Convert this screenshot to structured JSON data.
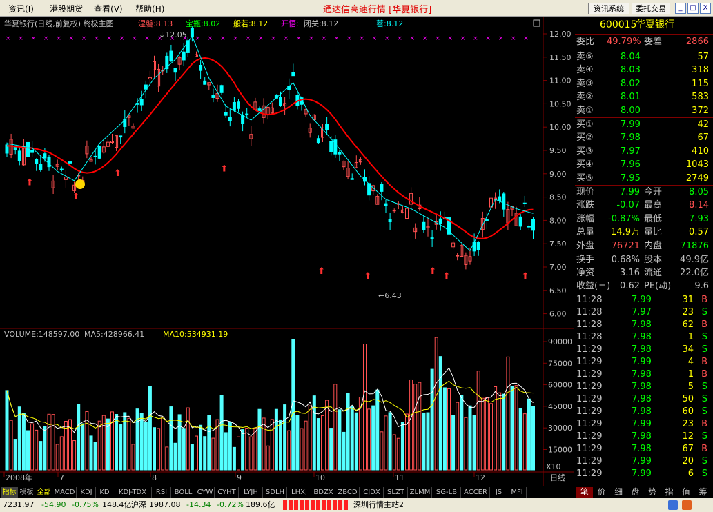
{
  "menu": {
    "items": [
      "资讯",
      "港股期货",
      "查看",
      "帮助"
    ],
    "shortcuts": [
      "(I)",
      "(Y)",
      "(V)",
      "(H)"
    ]
  },
  "app_title": "通达信高速行情 [华夏银行]",
  "top_buttons": {
    "news": "资讯系统",
    "trade": "委托交易"
  },
  "window_buttons": [
    "_",
    "□",
    "X"
  ],
  "chart_header": {
    "name": "华夏银行(日线,前复权) 終极主图",
    "items": [
      {
        "label": "涅磐:8.13",
        "color": "#ff5050"
      },
      {
        "label": "宝瓶:8.02",
        "color": "#00ff00"
      },
      {
        "label": "般若:8.12",
        "color": "#ffff00"
      },
      {
        "label": "开悟:",
        "color": "#ff00ff"
      },
      {
        "label": "闭关:8.12",
        "color": "#c0c0c0"
      },
      {
        "label": "苕:8.12",
        "color": "#00ffff"
      }
    ]
  },
  "price_axis": [
    "12.00",
    "11.50",
    "11.00",
    "10.50",
    "10.00",
    "9.50",
    "9.00",
    "8.50",
    "8.00",
    "7.50",
    "7.00",
    "6.50",
    "6.00"
  ],
  "annotations": {
    "high": "12.05",
    "low": "6.43",
    "high_arrow": "↓",
    "low_arrow": "←"
  },
  "volume_header": {
    "volume": "VOLUME:148597.00",
    "ma5": "MA5:428966.41",
    "ma10": "MA10:534931.19"
  },
  "volume_axis": [
    "90000",
    "75000",
    "60000",
    "45000",
    "30000",
    "15000"
  ],
  "volume_unit": "X10",
  "date_axis": {
    "year": "2008年",
    "months": [
      "7",
      "8",
      "9",
      "10",
      "11",
      "12"
    ]
  },
  "period_label": "日线",
  "indicator_tabs": [
    "指标",
    "模板",
    "全部",
    "MACD",
    "KDJ",
    "KD",
    "KDJ-TDX",
    "RSI",
    "BOLL",
    "CYW",
    "CYHT",
    "LYJH",
    "SDLH",
    "LHXJ",
    "BDZX",
    "ZBCD",
    "CJDX",
    "SLZT",
    "ZLMM",
    "SG-LB",
    "ACCER",
    "JS",
    "MFI"
  ],
  "quote": {
    "code": "600015",
    "name": "华夏银行",
    "weibi_label": "委比",
    "weibi": "49.79%",
    "weicha_label": "委差",
    "weicha": "2866",
    "sells": [
      {
        "label": "卖⑤",
        "price": "8.04",
        "vol": "57"
      },
      {
        "label": "卖④",
        "price": "8.03",
        "vol": "318"
      },
      {
        "label": "卖③",
        "price": "8.02",
        "vol": "115"
      },
      {
        "label": "卖②",
        "price": "8.01",
        "vol": "583"
      },
      {
        "label": "卖①",
        "price": "8.00",
        "vol": "372"
      }
    ],
    "buys": [
      {
        "label": "买①",
        "price": "7.99",
        "vol": "42"
      },
      {
        "label": "买②",
        "price": "7.98",
        "vol": "67"
      },
      {
        "label": "买③",
        "price": "7.97",
        "vol": "410"
      },
      {
        "label": "买④",
        "price": "7.96",
        "vol": "1043"
      },
      {
        "label": "买⑤",
        "price": "7.95",
        "vol": "2749"
      }
    ],
    "stats": [
      {
        "l1": "现价",
        "v1": "7.99",
        "c1": "#00ff00",
        "l2": "今开",
        "v2": "8.05",
        "c2": "#00ff00"
      },
      {
        "l1": "涨跌",
        "v1": "-0.07",
        "c1": "#00ff00",
        "l2": "最高",
        "v2": "8.14",
        "c2": "#ff5050"
      },
      {
        "l1": "涨幅",
        "v1": "-0.87%",
        "c1": "#00ff00",
        "l2": "最低",
        "v2": "7.93",
        "c2": "#00ff00"
      },
      {
        "l1": "总量",
        "v1": "14.9万",
        "c1": "#ffff00",
        "l2": "量比",
        "v2": "0.57",
        "c2": "#ffff00"
      },
      {
        "l1": "外盘",
        "v1": "76721",
        "c1": "#ff5050",
        "l2": "内盘",
        "v2": "71876",
        "c2": "#00ff00"
      }
    ],
    "stats2": [
      {
        "l1": "换手",
        "v1": "0.68%",
        "l2": "股本",
        "v2": "49.9亿"
      },
      {
        "l1": "净资",
        "v1": "3.16",
        "l2": "流通",
        "v2": "22.0亿"
      },
      {
        "l1": "收益(三)",
        "v1": "0.62",
        "l2": "PE(动)",
        "v2": "9.6"
      }
    ],
    "ticks": [
      {
        "time": "11:28",
        "price": "7.99",
        "vol": "31",
        "side": "B"
      },
      {
        "time": "11:28",
        "price": "7.97",
        "vol": "23",
        "side": "S"
      },
      {
        "time": "11:28",
        "price": "7.98",
        "vol": "62",
        "side": "B"
      },
      {
        "time": "11:28",
        "price": "7.98",
        "vol": "1",
        "side": "S"
      },
      {
        "time": "11:29",
        "price": "7.98",
        "vol": "34",
        "side": "S"
      },
      {
        "time": "11:29",
        "price": "7.99",
        "vol": "4",
        "side": "B"
      },
      {
        "time": "11:29",
        "price": "7.98",
        "vol": "1",
        "side": "B"
      },
      {
        "time": "11:29",
        "price": "7.98",
        "vol": "5",
        "side": "S"
      },
      {
        "time": "11:29",
        "price": "7.98",
        "vol": "50",
        "side": "S"
      },
      {
        "time": "11:29",
        "price": "7.98",
        "vol": "60",
        "side": "S"
      },
      {
        "time": "11:29",
        "price": "7.99",
        "vol": "23",
        "side": "B"
      },
      {
        "time": "11:29",
        "price": "7.98",
        "vol": "12",
        "side": "S"
      },
      {
        "time": "11:29",
        "price": "7.98",
        "vol": "67",
        "side": "B"
      },
      {
        "time": "11:29",
        "price": "7.99",
        "vol": "20",
        "side": "S"
      },
      {
        "time": "11:29",
        "price": "7.99",
        "vol": "6",
        "side": "S"
      }
    ],
    "side_tabs": [
      "笔",
      "价",
      "细",
      "盘",
      "势",
      "指",
      "值",
      "筹"
    ]
  },
  "status": {
    "sh_index": "7231.97",
    "sh_change": "-54.90",
    "sh_pct": "-0.75%",
    "sh_amount": "148.4亿",
    "hs_label": "沪深",
    "hs_index": "1987.08",
    "hs_change": "-14.34",
    "hs_pct": "-0.72%",
    "hs_amount": "189.6亿",
    "server": "深圳行情主站2"
  },
  "colors": {
    "up": "#ff5050",
    "down": "#00ff00",
    "vol_up": "#ff5050",
    "vol_down": "#54ffff",
    "ma_long": "#ff0000",
    "axis": "#800000"
  }
}
